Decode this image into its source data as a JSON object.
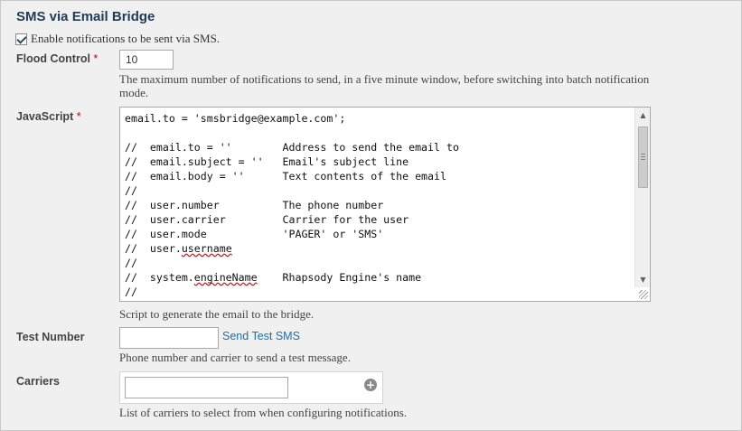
{
  "section": {
    "title": "SMS via Email Bridge"
  },
  "enable": {
    "checked": true,
    "label": "Enable notifications to be sent via SMS."
  },
  "flood_control": {
    "label": "Flood Control",
    "required_mark": "*",
    "value": "10",
    "help_line1": "The maximum number of notifications to send, in a five minute window, before switching into batch notification",
    "help_line2": "mode."
  },
  "javascript": {
    "label": "JavaScript",
    "required_mark": "*",
    "lines": [
      "email.to = 'smsbridge@example.com';",
      "",
      "//  email.to = ''        Address to send the email to",
      "//  email.subject = ''   Email's subject line",
      "//  email.body = ''      Text contents of the email",
      "//",
      "//  user.number          The phone number",
      "//  user.carrier         Carrier for the user",
      "//  user.mode            'PAGER' or 'SMS'",
      "//  user.username",
      "//",
      "//  system.engineName    Rhapsody Engine's name",
      "//"
    ],
    "help": "Script to generate the email to the bridge."
  },
  "test_number": {
    "label": "Test Number",
    "value": "",
    "link": "Send Test SMS",
    "help": "Phone number and carrier to send a test message."
  },
  "carriers": {
    "label": "Carriers",
    "value": "",
    "add_icon": "plus-circle-icon",
    "help": "List of carriers to select from when configuring notifications."
  },
  "colors": {
    "title": "#1f3b55",
    "link": "#1a6fb0",
    "required": "#cc0000"
  }
}
